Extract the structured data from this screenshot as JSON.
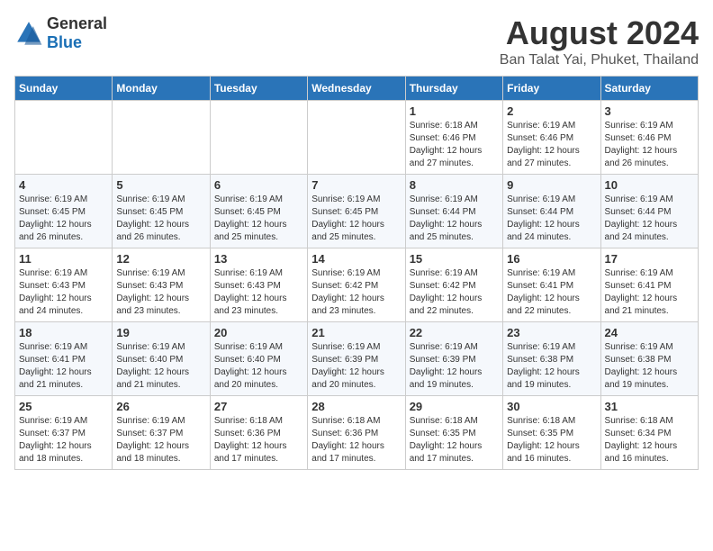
{
  "app": {
    "name_general": "General",
    "name_blue": "Blue"
  },
  "header": {
    "month_year": "August 2024",
    "location": "Ban Talat Yai, Phuket, Thailand"
  },
  "days_of_week": [
    "Sunday",
    "Monday",
    "Tuesday",
    "Wednesday",
    "Thursday",
    "Friday",
    "Saturday"
  ],
  "weeks": [
    [
      {
        "day": "",
        "sunrise": "",
        "sunset": "",
        "daylight": ""
      },
      {
        "day": "",
        "sunrise": "",
        "sunset": "",
        "daylight": ""
      },
      {
        "day": "",
        "sunrise": "",
        "sunset": "",
        "daylight": ""
      },
      {
        "day": "",
        "sunrise": "",
        "sunset": "",
        "daylight": ""
      },
      {
        "day": "1",
        "sunrise": "Sunrise: 6:18 AM",
        "sunset": "Sunset: 6:46 PM",
        "daylight": "Daylight: 12 hours and 27 minutes."
      },
      {
        "day": "2",
        "sunrise": "Sunrise: 6:19 AM",
        "sunset": "Sunset: 6:46 PM",
        "daylight": "Daylight: 12 hours and 27 minutes."
      },
      {
        "day": "3",
        "sunrise": "Sunrise: 6:19 AM",
        "sunset": "Sunset: 6:46 PM",
        "daylight": "Daylight: 12 hours and 26 minutes."
      }
    ],
    [
      {
        "day": "4",
        "sunrise": "Sunrise: 6:19 AM",
        "sunset": "Sunset: 6:45 PM",
        "daylight": "Daylight: 12 hours and 26 minutes."
      },
      {
        "day": "5",
        "sunrise": "Sunrise: 6:19 AM",
        "sunset": "Sunset: 6:45 PM",
        "daylight": "Daylight: 12 hours and 26 minutes."
      },
      {
        "day": "6",
        "sunrise": "Sunrise: 6:19 AM",
        "sunset": "Sunset: 6:45 PM",
        "daylight": "Daylight: 12 hours and 25 minutes."
      },
      {
        "day": "7",
        "sunrise": "Sunrise: 6:19 AM",
        "sunset": "Sunset: 6:45 PM",
        "daylight": "Daylight: 12 hours and 25 minutes."
      },
      {
        "day": "8",
        "sunrise": "Sunrise: 6:19 AM",
        "sunset": "Sunset: 6:44 PM",
        "daylight": "Daylight: 12 hours and 25 minutes."
      },
      {
        "day": "9",
        "sunrise": "Sunrise: 6:19 AM",
        "sunset": "Sunset: 6:44 PM",
        "daylight": "Daylight: 12 hours and 24 minutes."
      },
      {
        "day": "10",
        "sunrise": "Sunrise: 6:19 AM",
        "sunset": "Sunset: 6:44 PM",
        "daylight": "Daylight: 12 hours and 24 minutes."
      }
    ],
    [
      {
        "day": "11",
        "sunrise": "Sunrise: 6:19 AM",
        "sunset": "Sunset: 6:43 PM",
        "daylight": "Daylight: 12 hours and 24 minutes."
      },
      {
        "day": "12",
        "sunrise": "Sunrise: 6:19 AM",
        "sunset": "Sunset: 6:43 PM",
        "daylight": "Daylight: 12 hours and 23 minutes."
      },
      {
        "day": "13",
        "sunrise": "Sunrise: 6:19 AM",
        "sunset": "Sunset: 6:43 PM",
        "daylight": "Daylight: 12 hours and 23 minutes."
      },
      {
        "day": "14",
        "sunrise": "Sunrise: 6:19 AM",
        "sunset": "Sunset: 6:42 PM",
        "daylight": "Daylight: 12 hours and 23 minutes."
      },
      {
        "day": "15",
        "sunrise": "Sunrise: 6:19 AM",
        "sunset": "Sunset: 6:42 PM",
        "daylight": "Daylight: 12 hours and 22 minutes."
      },
      {
        "day": "16",
        "sunrise": "Sunrise: 6:19 AM",
        "sunset": "Sunset: 6:41 PM",
        "daylight": "Daylight: 12 hours and 22 minutes."
      },
      {
        "day": "17",
        "sunrise": "Sunrise: 6:19 AM",
        "sunset": "Sunset: 6:41 PM",
        "daylight": "Daylight: 12 hours and 21 minutes."
      }
    ],
    [
      {
        "day": "18",
        "sunrise": "Sunrise: 6:19 AM",
        "sunset": "Sunset: 6:41 PM",
        "daylight": "Daylight: 12 hours and 21 minutes."
      },
      {
        "day": "19",
        "sunrise": "Sunrise: 6:19 AM",
        "sunset": "Sunset: 6:40 PM",
        "daylight": "Daylight: 12 hours and 21 minutes."
      },
      {
        "day": "20",
        "sunrise": "Sunrise: 6:19 AM",
        "sunset": "Sunset: 6:40 PM",
        "daylight": "Daylight: 12 hours and 20 minutes."
      },
      {
        "day": "21",
        "sunrise": "Sunrise: 6:19 AM",
        "sunset": "Sunset: 6:39 PM",
        "daylight": "Daylight: 12 hours and 20 minutes."
      },
      {
        "day": "22",
        "sunrise": "Sunrise: 6:19 AM",
        "sunset": "Sunset: 6:39 PM",
        "daylight": "Daylight: 12 hours and 19 minutes."
      },
      {
        "day": "23",
        "sunrise": "Sunrise: 6:19 AM",
        "sunset": "Sunset: 6:38 PM",
        "daylight": "Daylight: 12 hours and 19 minutes."
      },
      {
        "day": "24",
        "sunrise": "Sunrise: 6:19 AM",
        "sunset": "Sunset: 6:38 PM",
        "daylight": "Daylight: 12 hours and 19 minutes."
      }
    ],
    [
      {
        "day": "25",
        "sunrise": "Sunrise: 6:19 AM",
        "sunset": "Sunset: 6:37 PM",
        "daylight": "Daylight: 12 hours and 18 minutes."
      },
      {
        "day": "26",
        "sunrise": "Sunrise: 6:19 AM",
        "sunset": "Sunset: 6:37 PM",
        "daylight": "Daylight: 12 hours and 18 minutes."
      },
      {
        "day": "27",
        "sunrise": "Sunrise: 6:18 AM",
        "sunset": "Sunset: 6:36 PM",
        "daylight": "Daylight: 12 hours and 17 minutes."
      },
      {
        "day": "28",
        "sunrise": "Sunrise: 6:18 AM",
        "sunset": "Sunset: 6:36 PM",
        "daylight": "Daylight: 12 hours and 17 minutes."
      },
      {
        "day": "29",
        "sunrise": "Sunrise: 6:18 AM",
        "sunset": "Sunset: 6:35 PM",
        "daylight": "Daylight: 12 hours and 17 minutes."
      },
      {
        "day": "30",
        "sunrise": "Sunrise: 6:18 AM",
        "sunset": "Sunset: 6:35 PM",
        "daylight": "Daylight: 12 hours and 16 minutes."
      },
      {
        "day": "31",
        "sunrise": "Sunrise: 6:18 AM",
        "sunset": "Sunset: 6:34 PM",
        "daylight": "Daylight: 12 hours and 16 minutes."
      }
    ]
  ]
}
